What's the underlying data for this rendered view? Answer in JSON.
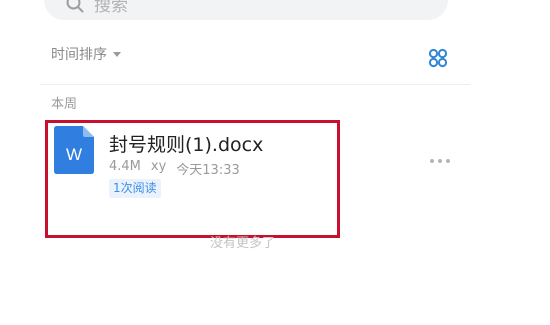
{
  "search": {
    "placeholder": "搜索"
  },
  "sort": {
    "label": "时间排序"
  },
  "section": {
    "label": "本周"
  },
  "file": {
    "name": "封号规则(1).docx",
    "size": "4.4M",
    "owner": "xy",
    "time": "今天13:33",
    "reads": "1次阅读",
    "icon_letter": "W"
  },
  "footer": {
    "end_text": "没有更多了"
  },
  "colors": {
    "accent": "#3c8ee6",
    "doc_icon": "#2f7ee0",
    "highlight": "#c8102e"
  }
}
